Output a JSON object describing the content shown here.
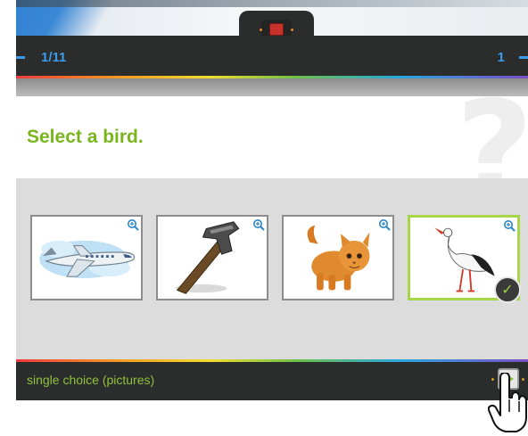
{
  "toolbar": {
    "record_icon": "record-stop-icon"
  },
  "header": {
    "page_indicator": "1/11",
    "score": "1"
  },
  "question": {
    "prompt": "Select a bird."
  },
  "choices": [
    {
      "picture": "airplane",
      "zoom_icon": "zoom-in-icon",
      "selected": false
    },
    {
      "picture": "hammer",
      "zoom_icon": "zoom-in-icon",
      "selected": false
    },
    {
      "picture": "kitten",
      "zoom_icon": "zoom-in-icon",
      "selected": false
    },
    {
      "picture": "stork",
      "zoom_icon": "zoom-in-icon",
      "selected": true,
      "check_icon": "checkmark-icon"
    }
  ],
  "footer": {
    "question_type": "single choice (pictures)",
    "next_icon": "play-next-icon"
  },
  "colors": {
    "accent_blue": "#3a9bea",
    "accent_green": "#7ab51d",
    "selected_border": "#a9d54a",
    "bar_dark": "#2b2c2c"
  }
}
